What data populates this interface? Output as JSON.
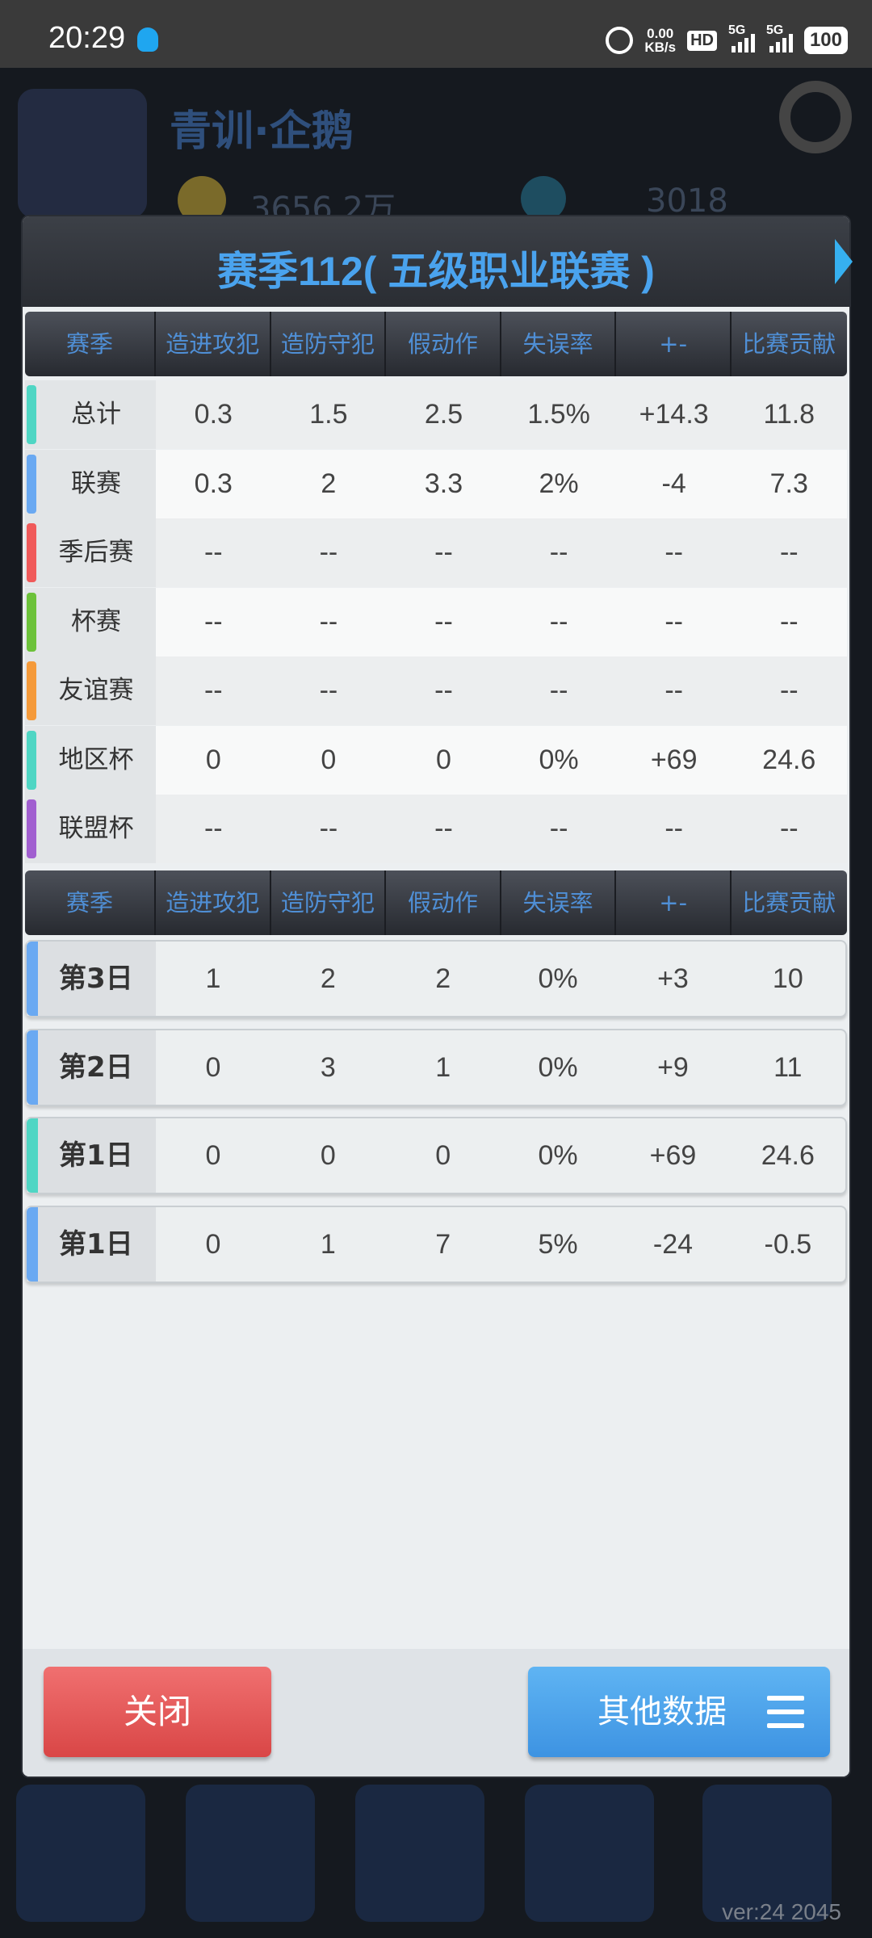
{
  "status_bar": {
    "time": "20:29",
    "net_speed_value": "0.00",
    "net_speed_unit": "KB/s",
    "hd_label": "HD",
    "sim1": "5G",
    "sim2": "5G",
    "battery": "100"
  },
  "background": {
    "team_title": "青训·企鹅",
    "money": "3656.2万",
    "gems": "3018",
    "version": "ver:24  2045"
  },
  "dialog": {
    "title": "赛季112( 五级职业联赛 )",
    "columns": [
      "赛季",
      "造进攻犯规",
      "造防守犯规",
      "假动作",
      "失误率",
      "+-",
      "比赛贡献值"
    ],
    "season_rows": [
      {
        "label": "总计",
        "color": "#4fd6c4",
        "values": [
          "0.3",
          "1.5",
          "2.5",
          "1.5%",
          "+14.3",
          "11.8"
        ]
      },
      {
        "label": "联赛",
        "color": "#6aa9f2",
        "values": [
          "0.3",
          "2",
          "3.3",
          "2%",
          "-4",
          "7.3"
        ]
      },
      {
        "label": "季后赛",
        "color": "#f05a5a",
        "values": [
          "--",
          "--",
          "--",
          "--",
          "--",
          "--"
        ]
      },
      {
        "label": "杯赛",
        "color": "#6cc23a",
        "values": [
          "--",
          "--",
          "--",
          "--",
          "--",
          "--"
        ]
      },
      {
        "label": "友谊赛",
        "color": "#f59a3a",
        "values": [
          "--",
          "--",
          "--",
          "--",
          "--",
          "--"
        ]
      },
      {
        "label": "地区杯",
        "color": "#4fd6c4",
        "values": [
          "0",
          "0",
          "0",
          "0%",
          "+69",
          "24.6"
        ]
      },
      {
        "label": "联盟杯",
        "color": "#a15fd0",
        "values": [
          "--",
          "--",
          "--",
          "--",
          "--",
          "--"
        ]
      }
    ],
    "game_rows": [
      {
        "label": "第3日",
        "color": "#6aa9f2",
        "values": [
          "1",
          "2",
          "2",
          "0%",
          "+3",
          "10"
        ]
      },
      {
        "label": "第2日",
        "color": "#6aa9f2",
        "values": [
          "0",
          "3",
          "1",
          "0%",
          "+9",
          "11"
        ]
      },
      {
        "label": "第1日",
        "color": "#4fd6c4",
        "values": [
          "0",
          "0",
          "0",
          "0%",
          "+69",
          "24.6"
        ]
      },
      {
        "label": "第1日",
        "color": "#6aa9f2",
        "values": [
          "0",
          "1",
          "7",
          "5%",
          "-24",
          "-0.5"
        ]
      }
    ],
    "close_label": "关闭",
    "other_label": "其他数据"
  }
}
